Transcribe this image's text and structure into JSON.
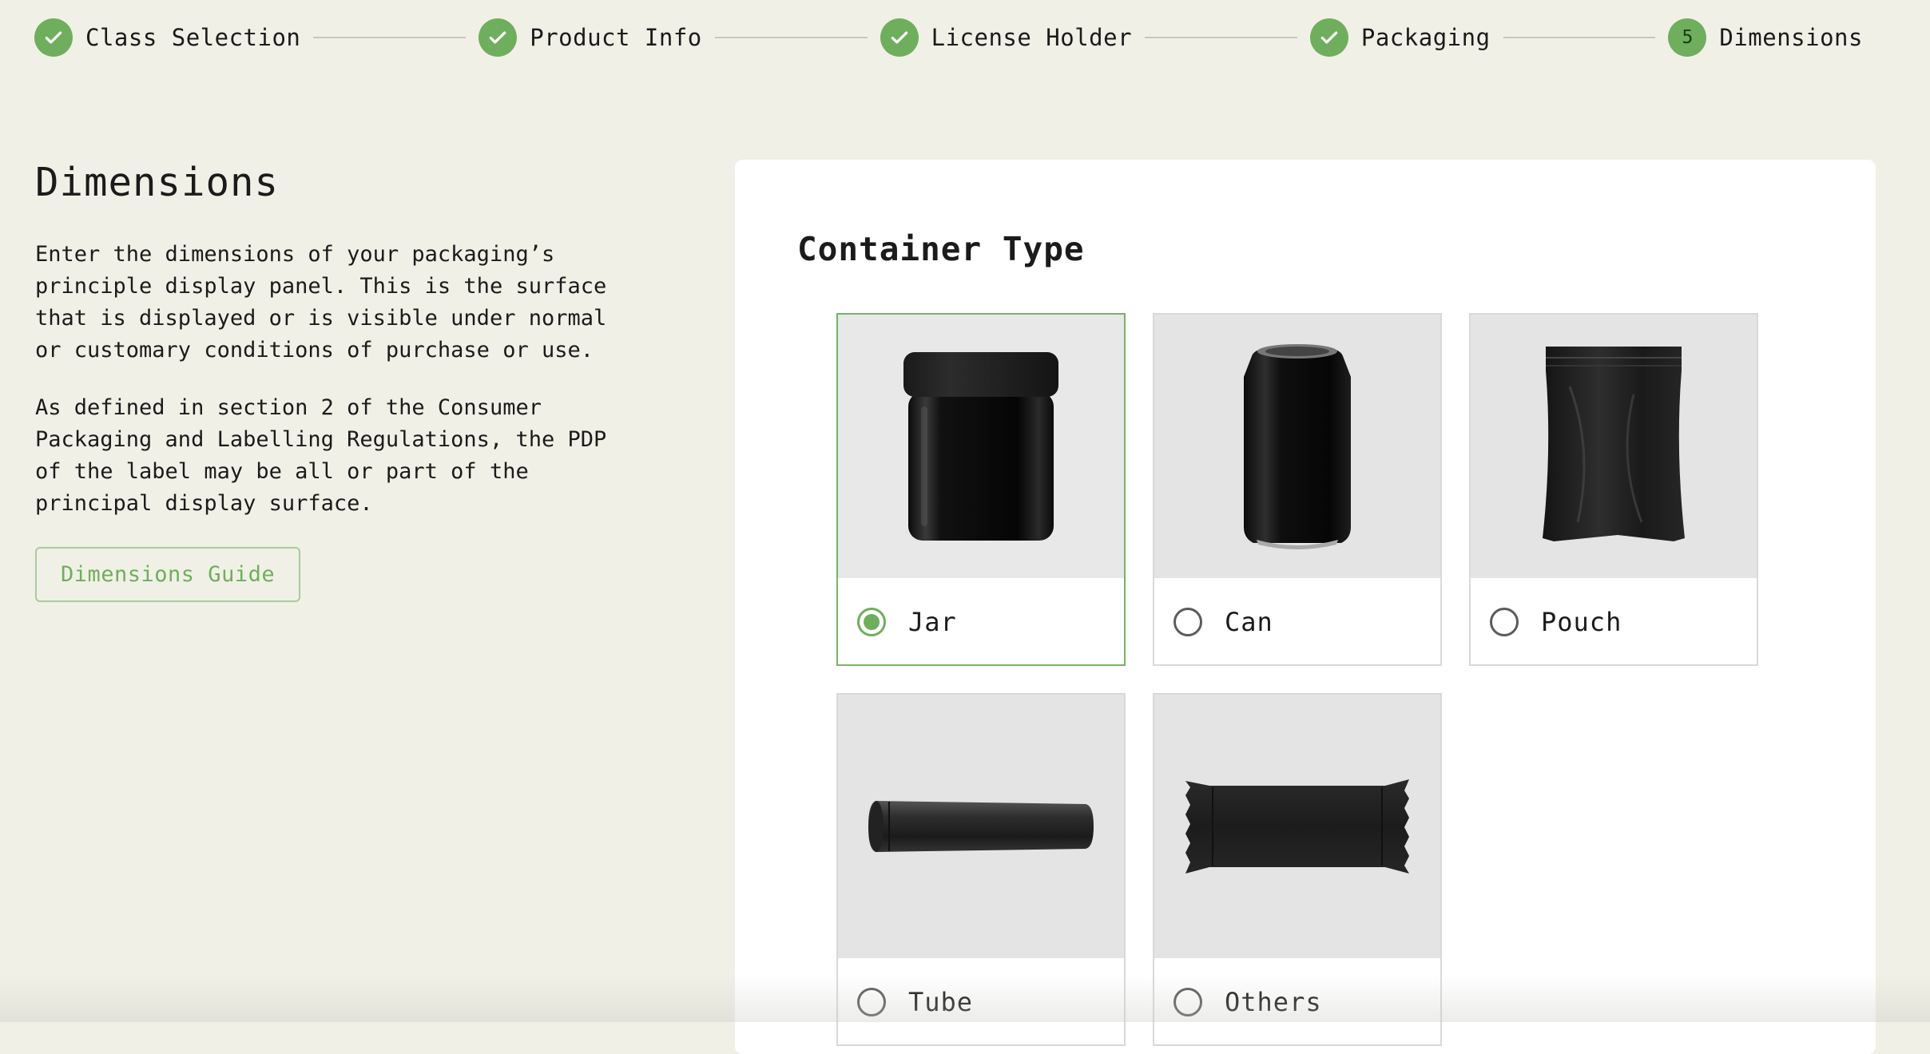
{
  "stepper": {
    "steps": [
      {
        "label": "Class Selection",
        "status": "complete"
      },
      {
        "label": "Product Info",
        "status": "complete"
      },
      {
        "label": "License Holder",
        "status": "complete"
      },
      {
        "label": "Packaging",
        "status": "complete"
      },
      {
        "label": "Dimensions",
        "status": "current",
        "number": "5"
      }
    ]
  },
  "main": {
    "title": "Dimensions",
    "paragraph_1": "Enter the dimensions of your packaging’s principle display panel. This is the surface that is displayed or is visible under normal or customary conditions of purchase or use.",
    "paragraph_2": "As defined in section 2 of the Consumer Packaging and Labelling Regulations, the PDP of the label may be all or part of the principal display surface.",
    "guide_button": "Dimensions Guide"
  },
  "container": {
    "title": "Container Type",
    "options": [
      {
        "label": "Jar",
        "selected": true,
        "icon": "jar-icon"
      },
      {
        "label": "Can",
        "selected": false,
        "icon": "can-icon"
      },
      {
        "label": "Pouch",
        "selected": false,
        "icon": "pouch-icon"
      },
      {
        "label": "Tube",
        "selected": false,
        "icon": "tube-icon"
      },
      {
        "label": "Others",
        "selected": false,
        "icon": "wrapper-icon"
      }
    ]
  },
  "colors": {
    "accent": "#6fae5d",
    "background": "#f1f0e6",
    "card": "#ffffff"
  }
}
